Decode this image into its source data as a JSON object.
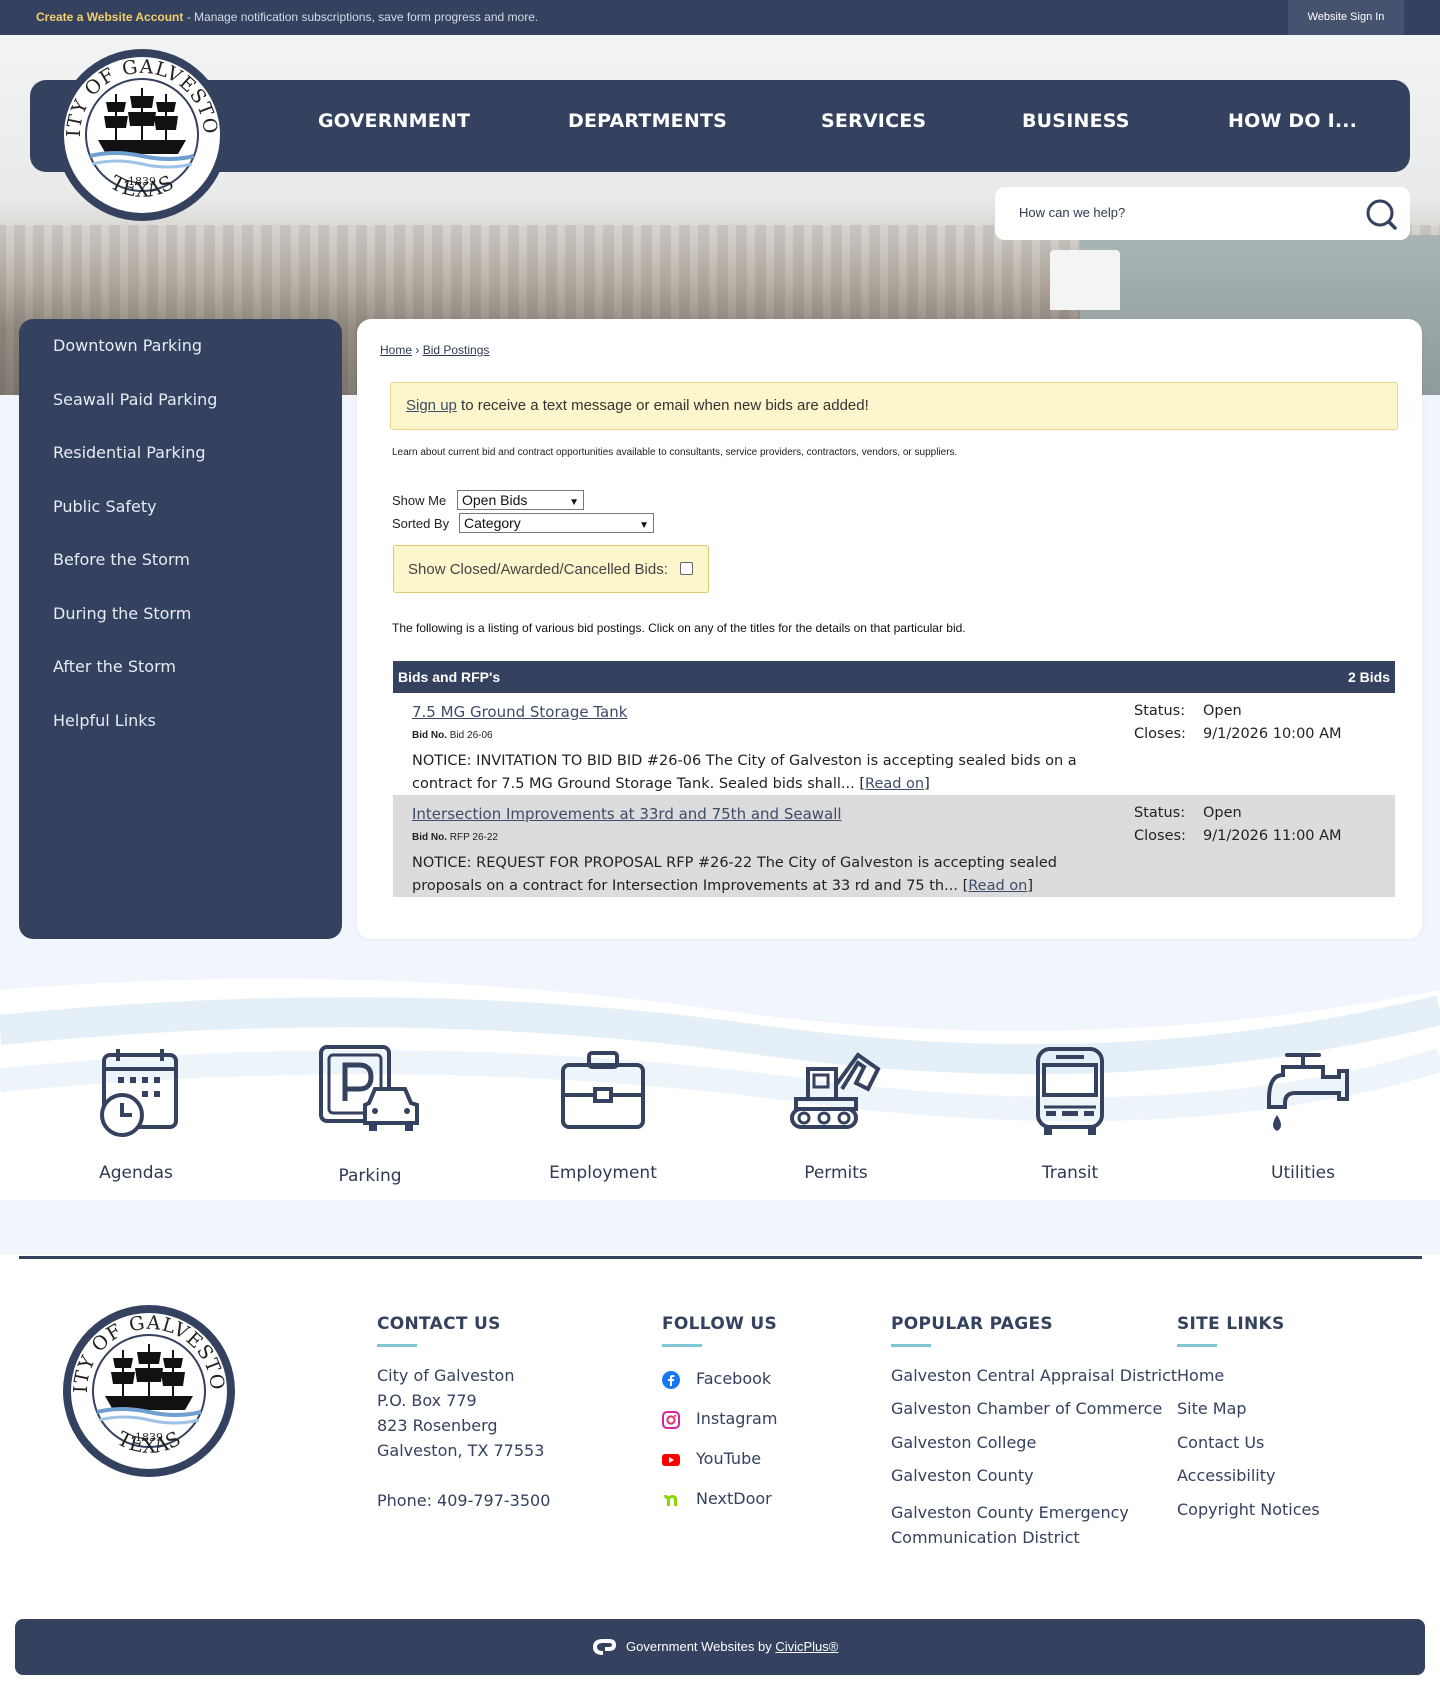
{
  "topbar": {
    "create_account": "Create a Website Account",
    "create_account_desc": " - Manage notification subscriptions, save form progress and more.",
    "sign_in": "Website Sign In"
  },
  "logo": {
    "top_text": "CITY OF GALVESTON",
    "year": "1839",
    "bottom_text": "TEXAS"
  },
  "nav": {
    "items": [
      "GOVERNMENT",
      "DEPARTMENTS",
      "SERVICES",
      "BUSINESS",
      "HOW DO I..."
    ]
  },
  "search": {
    "placeholder": "How can we help?",
    "icon": "search-icon"
  },
  "sidebar": {
    "items": [
      "Downtown Parking",
      "Seawall Paid Parking",
      "Residential Parking",
      "Public Safety",
      "Before the Storm",
      "During the Storm",
      "After the Storm",
      "Helpful Links"
    ]
  },
  "breadcrumb": {
    "home": "Home",
    "separator": "›",
    "current": "Bid Postings"
  },
  "signup": {
    "link": "Sign up",
    "text": " to receive a text message or email when new bids are added!"
  },
  "intro": "Learn about current bid and contract opportunities available to consultants, service providers, contractors, vendors, or suppliers.",
  "filters": {
    "show_me_label": "Show Me",
    "show_me_value": "Open Bids",
    "sorted_by_label": "Sorted By",
    "sorted_by_value": "Category",
    "closed_label": "Show Closed/Awarded/Cancelled Bids:",
    "closed_checked": false
  },
  "listing_text": "The following is a listing of various bid postings. Click on any of the titles for the details on that particular bid.",
  "bids": {
    "header": "Bids and RFP's",
    "count": "2 Bids",
    "items": [
      {
        "title": "7.5 MG Ground Storage Tank",
        "bid_no_label": "Bid No.",
        "bid_no": "Bid 26-06",
        "desc": "NOTICE: INVITATION TO BID BID #26-06 The City of Galveston is accepting sealed bids on a contract for 7.5 MG Ground Storage Tank. Sealed bids shall... ",
        "read_on": "Read on",
        "status_label": "Status:",
        "status": "Open",
        "closes_label": "Closes:",
        "closes": "9/1/2026 10:00 AM"
      },
      {
        "title": "Intersection Improvements at 33rd and 75th and Seawall",
        "bid_no_label": "Bid No.",
        "bid_no": "RFP 26-22",
        "desc": "NOTICE: REQUEST FOR PROPOSAL RFP #26-22 The City of Galveston is accepting sealed proposals on a contract for Intersection Improvements at 33 rd and 75 th... ",
        "read_on": "Read on",
        "status_label": "Status:",
        "status": "Open",
        "closes_label": "Closes:",
        "closes": "9/1/2026 11:00 AM"
      }
    ]
  },
  "quick_links": [
    {
      "label": "Agendas",
      "icon": "calendar-clock-icon"
    },
    {
      "label": "Parking",
      "icon": "parking-car-icon"
    },
    {
      "label": "Employment",
      "icon": "briefcase-icon"
    },
    {
      "label": "Permits",
      "icon": "excavator-icon"
    },
    {
      "label": "Transit",
      "icon": "bus-icon"
    },
    {
      "label": "Utilities",
      "icon": "faucet-icon"
    }
  ],
  "footer": {
    "contact": {
      "heading": "CONTACT US",
      "lines": [
        "City of Galveston",
        "P.O. Box 779",
        "823 Rosenberg",
        "Galveston, TX 77553"
      ],
      "phone": "Phone: 409-797-3500"
    },
    "follow": {
      "heading": "FOLLOW US",
      "items": [
        {
          "label": "Facebook",
          "icon": "facebook-icon",
          "color": "#1877f2"
        },
        {
          "label": "Instagram",
          "icon": "instagram-icon",
          "color": "#d6249f"
        },
        {
          "label": "YouTube",
          "icon": "youtube-icon",
          "color": "#ff0000"
        },
        {
          "label": "NextDoor",
          "icon": "nextdoor-icon",
          "color": "#8ed500"
        }
      ]
    },
    "popular": {
      "heading": "POPULAR PAGES",
      "items": [
        "Galveston Central Appraisal District",
        "Galveston Chamber of Commerce",
        "Galveston College",
        "Galveston County",
        "Galveston County Emergency Communication District"
      ]
    },
    "site_links": {
      "heading": "SITE LINKS",
      "items": [
        "Home",
        "Site Map",
        "Contact Us",
        "Accessibility",
        "Copyright Notices"
      ]
    }
  },
  "bottom": {
    "text": "Government Websites by ",
    "link": "CivicPlus®"
  },
  "colors": {
    "navy": "#34415f",
    "yellow_box": "#fdf5cc",
    "accent_teal": "#7fc7d6",
    "row_alt": "#dcdcdc"
  }
}
